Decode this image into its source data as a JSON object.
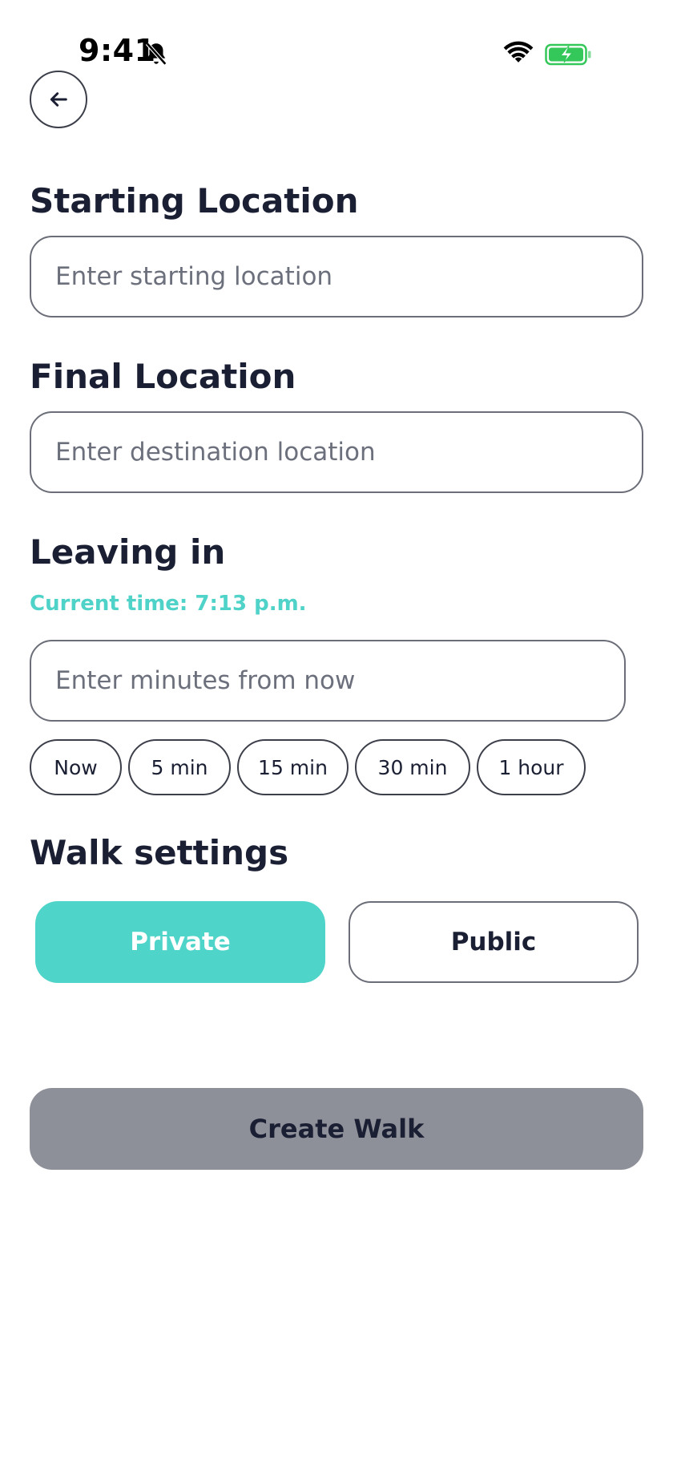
{
  "status_bar": {
    "time": "9:41",
    "icons": [
      "bell-slash-icon",
      "wifi-icon",
      "battery-charging-icon"
    ],
    "battery_color": "#34c759"
  },
  "header": {
    "back_icon": "arrow-left-icon"
  },
  "starting_location": {
    "title": "Starting Location",
    "placeholder": "Enter starting location",
    "value": ""
  },
  "final_location": {
    "title": "Final Location",
    "placeholder": "Enter destination location",
    "value": ""
  },
  "leaving_in": {
    "title": "Leaving in",
    "current_time": "Current time: 7:13 p.m.",
    "placeholder": "Enter minutes from now",
    "value": "",
    "quick_options": [
      {
        "label": "Now"
      },
      {
        "label": "5 min"
      },
      {
        "label": "15 min"
      },
      {
        "label": "30 min"
      },
      {
        "label": "1 hour"
      }
    ]
  },
  "walk_settings": {
    "title": "Walk settings",
    "options": [
      {
        "label": "Private",
        "selected": true
      },
      {
        "label": "Public",
        "selected": false
      }
    ]
  },
  "actions": {
    "create_label": "Create Walk"
  },
  "colors": {
    "accent": "#4fd4c9",
    "heading": "#1b1f33",
    "disabled_button": "#8e9099",
    "border": "#6b6e78"
  }
}
